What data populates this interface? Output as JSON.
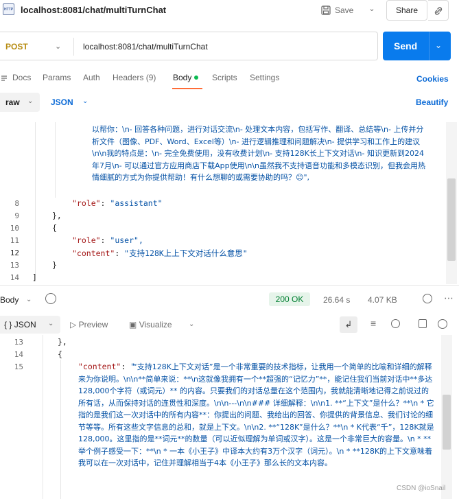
{
  "request": {
    "title": "localhost:8081/chat/multiTurnChat",
    "save_label": "Save",
    "share_label": "Share",
    "method": "POST",
    "url": "localhost:8081/chat/multiTurnChat",
    "send_label": "Send"
  },
  "tabs": [
    {
      "label": "Docs"
    },
    {
      "label": "Params"
    },
    {
      "label": "Auth"
    },
    {
      "label": "Headers (9)"
    },
    {
      "label": "Body"
    },
    {
      "label": "Scripts"
    },
    {
      "label": "Settings"
    }
  ],
  "cookies_label": "Cookies",
  "body_mode": "raw",
  "body_format": "JSON",
  "beautify_label": "Beautify",
  "request_body": {
    "wrapped_text": "以帮你：\\n- 回答各种问题，进行对话交流\\n- 处理文本内容，包括写作、翻译、总结等\\n- 上传并分析文件（图像、PDF、Word、Excel等）\\n- 进行逻辑推理和问题解决\\n- 提供学习和工作上的建议\\n\\n我的特点是：\\n- 完全免费使用，没有收费计划\\n- 支持128K长上下文对话\\n- 知识更新到2024年7月\\n- 可以通过官方应用商店下载App使用\\n\\n虽然我不支持语音功能和多模态识别，但我会用热情细腻的方式为你提供帮助！有什么想聊的或需要协助的吗？😊\",",
    "lines": [
      {
        "n": "8",
        "key": "\"role\"",
        "value": "\"assistant\""
      },
      {
        "n": "9",
        "text": "},"
      },
      {
        "n": "10",
        "text": "{"
      },
      {
        "n": "11",
        "key": "\"role\"",
        "value": "\"user\","
      },
      {
        "n": "12",
        "key": "\"content\"",
        "value": "\"支持128K上上下文对话什么意思\""
      },
      {
        "n": "13",
        "text": "}"
      },
      {
        "n": "14",
        "text": "]"
      }
    ]
  },
  "response": {
    "body_label": "Body",
    "status": "200 OK",
    "time": "26.64 s",
    "size": "4.07 KB",
    "format": "JSON",
    "preview_label": "Preview",
    "visualize_label": "Visualize",
    "lines": [
      {
        "n": "13",
        "text": "},"
      },
      {
        "n": "14",
        "text": "{"
      },
      {
        "n": "15",
        "key": "\"content\"",
        "value": "\""
      }
    ],
    "wrapped_text": "“支持128K上下文对话”是一个非常重要的技术指标，让我用一个简单的比喻和详细的解释来为你说明。\\n\\n**简单来说：**\\n这就像我拥有一个**超强的“记忆力”**，能记住我们当前对话中**多达128,000个字符（或词元）** 的内容。只要我们的对话总量在这个范围内，我就能清晰地记得之前说过的所有话，从而保持对话的连贯性和深度。\\n\\n---\\n\\n### 详细解释：\\n\\n1.  **“上下文”是什么？**\\n    *   它指的是我们这一次对话中的所有内容**：你提出的问题、我给出的回答、你提供的背景信息、我们讨论的细节等等。所有这些文字信息的总和，就是上下文。\\n\\n2.  **“128K”是什么？**\\n    *   K代表“千”，128K就是128,000。这里指的是**词元**的数量（可以近似理解为单词或汉字）。这是一个非常巨大的容量。\\n    *   **举个例子感受一下：**\\n    *   一本《小王子》中译本大约有3万个汉字（词元）。\\n        *   **128K的上下文意味着我可以在一次对话中，记住并理解相当于4本《小王子》那么长的文本内容。"
  },
  "watermark": "CSDN @ioSnail"
}
